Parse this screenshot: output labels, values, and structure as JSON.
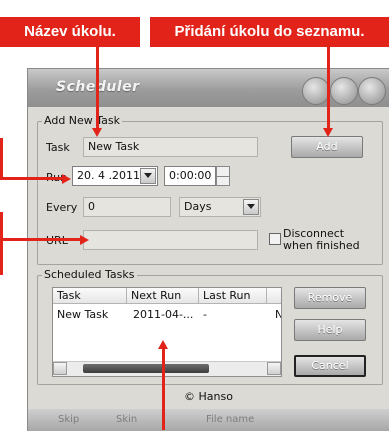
{
  "callouts": {
    "task_name": "Název úkolu.",
    "add_task": "Přidání úkolu do seznamu."
  },
  "window": {
    "title": "Scheduler"
  },
  "add_group": {
    "legend": "Add New Task",
    "task_label": "Task",
    "task_value": "New Task",
    "run_label": "Run",
    "date_value": "20. 4 .2011",
    "time_value": "0:00:00",
    "every_label": "Every",
    "every_value": "0",
    "unit_value": "Days",
    "url_label": "URL",
    "url_value": "",
    "add_button": "Add",
    "disconnect_label": "Disconnect when finished"
  },
  "scheduled_group": {
    "legend": "Scheduled Tasks",
    "columns": [
      "Task",
      "Next Run",
      "Last Run",
      ""
    ],
    "rows": [
      {
        "task": "New Task",
        "next_run": "2011-04-...",
        "last_run": "-",
        "extra": "N"
      }
    ],
    "remove_button": "Remove",
    "help_button": "Help",
    "cancel_button": "Cancel"
  },
  "footer": {
    "copyright": "© Hanso"
  },
  "bottom_bar": {
    "skip_label": "Skip",
    "skin_label": "Skin",
    "file_label": "File name"
  }
}
